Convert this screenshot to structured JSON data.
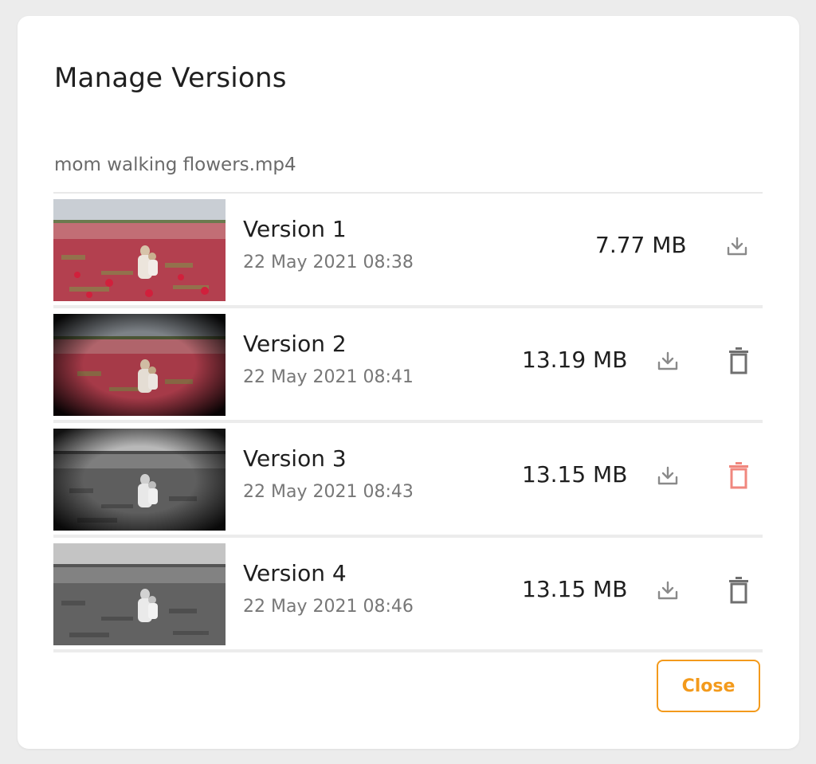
{
  "dialog": {
    "title": "Manage Versions",
    "filename": "mom walking flowers.mp4",
    "close_label": "Close"
  },
  "versions": [
    {
      "label": "Version 1",
      "date": "22 May 2021 08:38",
      "size": "7.77 MB",
      "deletable": false,
      "thumbnail_style": "color"
    },
    {
      "label": "Version 2",
      "date": "22 May 2021 08:41",
      "size": "13.19 MB",
      "deletable": true,
      "thumbnail_style": "color-vignette"
    },
    {
      "label": "Version 3",
      "date": "22 May 2021 08:43",
      "size": "13.15 MB",
      "deletable": true,
      "thumbnail_style": "grayscale-vignette",
      "delete_hovered": true
    },
    {
      "label": "Version 4",
      "date": "22 May 2021 08:46",
      "size": "13.15 MB",
      "deletable": true,
      "thumbnail_style": "grayscale"
    }
  ],
  "icons": {
    "download": "download-icon",
    "delete": "trash-icon"
  },
  "colors": {
    "accent": "#f39a1c",
    "delete_default": "#6f6f6f",
    "delete_hover": "#f0877e",
    "download": "#8a8a8a"
  }
}
